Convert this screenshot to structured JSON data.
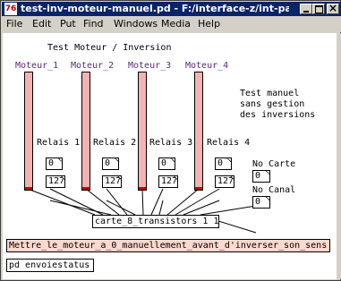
{
  "window": {
    "title": "test-inv-moteur-manuel.pd - F:/interface-z/int-pat...",
    "app_icon_glyph": "76"
  },
  "menu": [
    "File",
    "Edit",
    "Put",
    "Find",
    "Windows",
    "Media",
    "Help"
  ],
  "patch": {
    "header_comment": "Test Moteur / Inversion",
    "motors": [
      "Moteur_1",
      "Moteur_2",
      "Moteur_3",
      "Moteur_4"
    ],
    "motor_levels": [
      0,
      0,
      0,
      0
    ],
    "relays": [
      "Relais 1",
      "Relais 2",
      "Relais 3",
      "Relais 4"
    ],
    "number_boxes_top": [
      "0",
      "0",
      "0",
      "0"
    ],
    "number_boxes_bottom": [
      "127",
      "127",
      "127",
      "127"
    ],
    "note_lines": [
      "Test manuel",
      "sans gestion",
      "des inversions"
    ],
    "no_carte_label": "No Carte",
    "no_carte_value": "0",
    "no_canal_label": "No Canal",
    "no_canal_value": "0",
    "object_box": "carte_8_transistors 1 1",
    "message_box": "Mettre_le_moteur_a_0_manuellement_avant_d'inverser_son_sens",
    "status_box": "pd envoiestatus"
  },
  "colors": {
    "title_bar": "#0a246a",
    "slider_fill": "#f4b3b3",
    "slider_knob": "#cc0000",
    "motor_label": "#5a2a7e",
    "message_fill": "#fdd8cf"
  }
}
